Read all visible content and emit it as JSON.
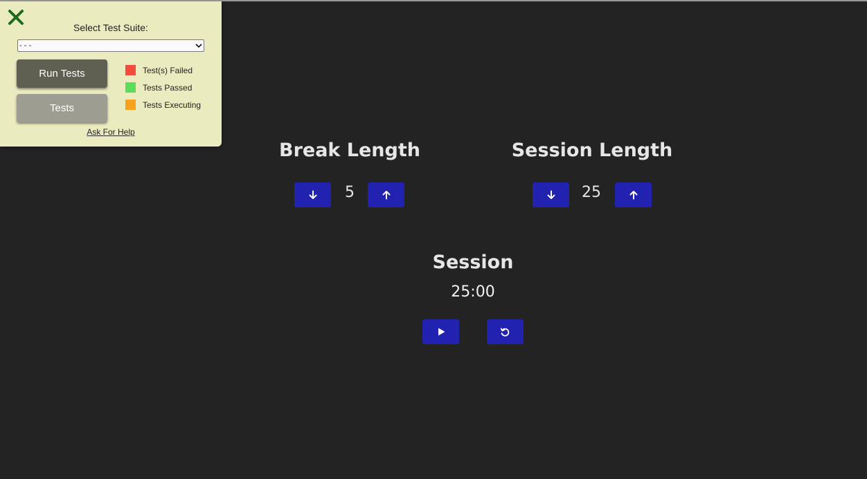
{
  "test_panel": {
    "close_icon": "close-x-icon",
    "suite_label": "Select Test Suite:",
    "suite_selected": "- - -",
    "run_tests_label": "Run Tests",
    "tests_label": "Tests",
    "legend": [
      {
        "label": "Test(s) Failed",
        "color": "#f44c3c"
      },
      {
        "label": "Tests Passed",
        "color": "#5bdc5b"
      },
      {
        "label": "Tests Executing",
        "color": "#f7a21e"
      }
    ],
    "help_label": "Ask For Help"
  },
  "clock": {
    "break_label": "Break Length",
    "break_value": "5",
    "session_label": "Session Length",
    "session_value": "25",
    "timer_label": "Session",
    "time_left": "25:00",
    "icons": {
      "decrement": "arrow-down-icon",
      "increment": "arrow-up-icon",
      "start_stop": "play-icon",
      "reset": "reset-icon"
    },
    "colors": {
      "button": "#2222b0",
      "background": "#232323"
    }
  }
}
